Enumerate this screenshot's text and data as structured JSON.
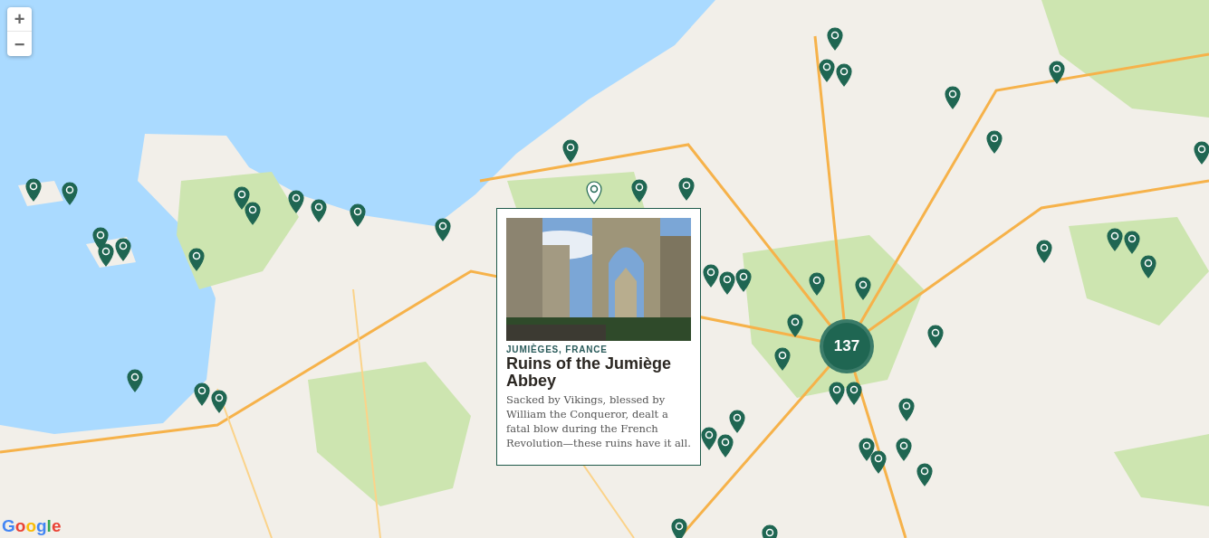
{
  "zoom_controls": {
    "zoom_in": "+",
    "zoom_out": "−"
  },
  "cluster": {
    "count": "137"
  },
  "markers": [
    {
      "selected": false
    },
    {
      "selected": false
    },
    {
      "selected": false
    },
    {
      "selected": false
    },
    {
      "selected": false
    },
    {
      "selected": false
    },
    {
      "selected": false
    },
    {
      "selected": false
    },
    {
      "selected": true
    },
    {
      "selected": false
    },
    {
      "selected": false
    },
    {
      "selected": false
    },
    {
      "selected": false
    },
    {
      "selected": false
    },
    {
      "selected": false
    },
    {
      "selected": false
    },
    {
      "selected": false
    },
    {
      "selected": false
    },
    {
      "selected": false
    },
    {
      "selected": false
    },
    {
      "selected": false
    },
    {
      "selected": false
    },
    {
      "selected": false
    },
    {
      "selected": false
    },
    {
      "selected": false
    },
    {
      "selected": false
    },
    {
      "selected": false
    },
    {
      "selected": false
    },
    {
      "selected": false
    },
    {
      "selected": false
    },
    {
      "selected": false
    },
    {
      "selected": false
    },
    {
      "selected": false
    },
    {
      "selected": false
    },
    {
      "selected": false
    },
    {
      "selected": false
    },
    {
      "selected": false
    },
    {
      "selected": false
    },
    {
      "selected": false
    },
    {
      "selected": false
    },
    {
      "selected": false
    },
    {
      "selected": false
    },
    {
      "selected": false
    },
    {
      "selected": false
    },
    {
      "selected": false
    },
    {
      "selected": false
    },
    {
      "selected": false
    },
    {
      "selected": false
    },
    {
      "selected": false
    },
    {
      "selected": false
    }
  ],
  "popup": {
    "location": "JUMIÈGES, FRANCE",
    "title": "Ruins of the Jumiège Abbey",
    "description": "Sacked by Vikings, blessed by William the Conqueror, dealt a fatal blow during the French Revolution—these ruins have it all."
  },
  "attribution": {
    "logo": "Google"
  }
}
